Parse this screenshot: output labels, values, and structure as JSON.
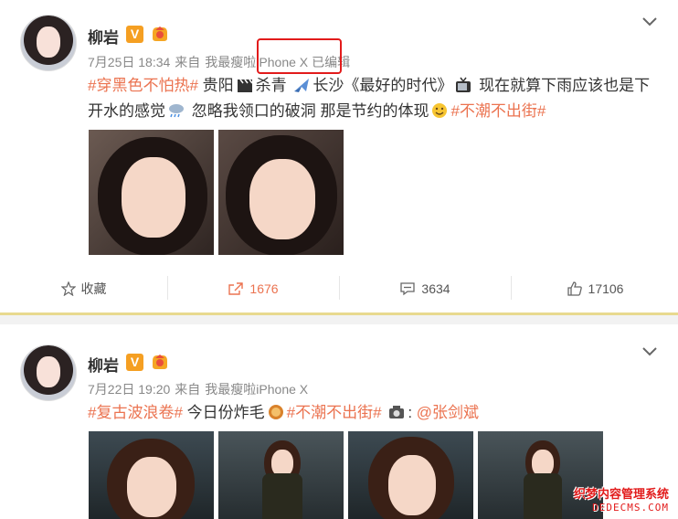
{
  "posts": [
    {
      "author": "柳岩",
      "date": "7月25日 18:34",
      "from_label": "来自",
      "device": "我最瘦啦iPhone X",
      "edited": "已编辑",
      "text": {
        "tag1": "#穿黑色不怕热#",
        "part1": "贵阳",
        "part2": "杀青",
        "part3": "长沙《最好的时代》",
        "part4": "现在就算下雨应该也是下开水的感觉",
        "part5": "忽略我领口的破洞 那是节约的体现",
        "tag2": "#不潮不出街#"
      },
      "actions": {
        "favorite": "收藏",
        "repost": "1676",
        "comment": "3634",
        "like": "17106"
      }
    },
    {
      "author": "柳岩",
      "date": "7月22日 19:20",
      "from_label": "来自",
      "device": "我最瘦啦iPhone X",
      "text": {
        "tag1": "#复古波浪卷#",
        "part1": "今日份炸毛",
        "tag2": "#不潮不出街#",
        "part2": ":",
        "mention": "@张剑斌"
      }
    }
  ],
  "watermark": {
    "line1": "织梦内容管理系统",
    "line2": "DEDECMS.COM"
  },
  "colors": {
    "tag": "#eb7350",
    "badge": "#f59f22",
    "highlight": "#e21b1b",
    "divider": "#e8d98f"
  },
  "icons": [
    "chevron-down-icon",
    "verified-v-icon",
    "fan-badge-icon",
    "clapperboard-icon",
    "airplane-icon",
    "tv-icon",
    "rain-cloud-icon",
    "smile-icon",
    "camera-icon",
    "star-icon",
    "repost-icon",
    "comment-icon",
    "like-icon"
  ]
}
